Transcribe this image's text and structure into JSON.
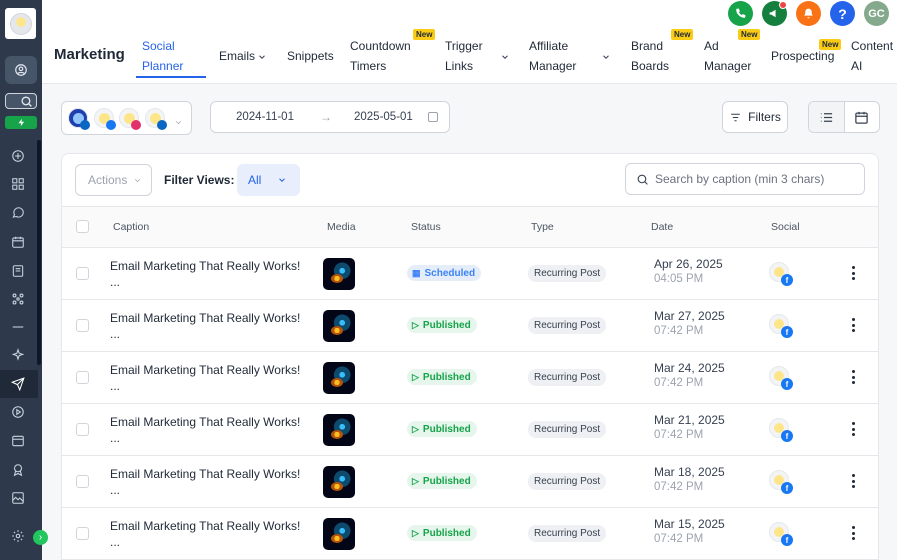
{
  "header": {
    "app_title": "Marketing",
    "nav": [
      {
        "line1": "Social",
        "line2": "Planner",
        "active": true
      },
      {
        "line1": "Emails",
        "line2": ""
      },
      {
        "line1": "Snippets",
        "line2": ""
      },
      {
        "line1": "Countdown",
        "line2": "Timers"
      },
      {
        "line1": "Trigger",
        "line2": "Links"
      },
      {
        "line1": "Affiliate",
        "line2": "Manager"
      },
      {
        "line1": "Brand",
        "line2": "Boards"
      },
      {
        "line1": "Ad",
        "line2": "Manager"
      },
      {
        "line1": "Prospecting",
        "line2": ""
      },
      {
        "line1": "Content",
        "line2": "AI"
      }
    ],
    "new_badge": "New",
    "user_initials": "GC",
    "help_glyph": "?"
  },
  "toolbar": {
    "date_from": "2024-11-01",
    "date_to": "2025-05-01",
    "date_arrow": "→",
    "filters_label": "Filters"
  },
  "table_controls": {
    "actions_label": "Actions",
    "filter_views_label": "Filter Views:",
    "filter_view_value": "All",
    "search_placeholder": "Search by caption (min 3 chars)"
  },
  "columns": [
    "Caption",
    "Media",
    "Status",
    "Type",
    "Date",
    "Social"
  ],
  "rows": [
    {
      "caption": "Email Marketing That Really Works!",
      "caption_more": "...",
      "status": "Scheduled",
      "type": "Recurring Post",
      "date": "Apr 26, 2025",
      "time": "04:05 PM"
    },
    {
      "caption": "Email Marketing That Really Works!",
      "caption_more": "...",
      "status": "Published",
      "type": "Recurring Post",
      "date": "Mar 27, 2025",
      "time": "07:42 PM"
    },
    {
      "caption": "Email Marketing That Really Works!",
      "caption_more": "...",
      "status": "Published",
      "type": "Recurring Post",
      "date": "Mar 24, 2025",
      "time": "07:42 PM"
    },
    {
      "caption": "Email Marketing That Really Works!",
      "caption_more": "...",
      "status": "Published",
      "type": "Recurring Post",
      "date": "Mar 21, 2025",
      "time": "07:42 PM"
    },
    {
      "caption": "Email Marketing That Really Works!",
      "caption_more": "...",
      "status": "Published",
      "type": "Recurring Post",
      "date": "Mar 18, 2025",
      "time": "07:42 PM"
    },
    {
      "caption": "Email Marketing That Really Works!",
      "caption_more": "...",
      "status": "Published",
      "type": "Recurring Post",
      "date": "Mar 15, 2025",
      "time": "07:42 PM"
    }
  ],
  "social_badge": "f",
  "colors": {
    "accent": "#2563eb",
    "rail_bg": "#2e3a4c",
    "published": "#16a34a",
    "scheduled": "#3b82f6",
    "new_badge": "#facc15"
  }
}
